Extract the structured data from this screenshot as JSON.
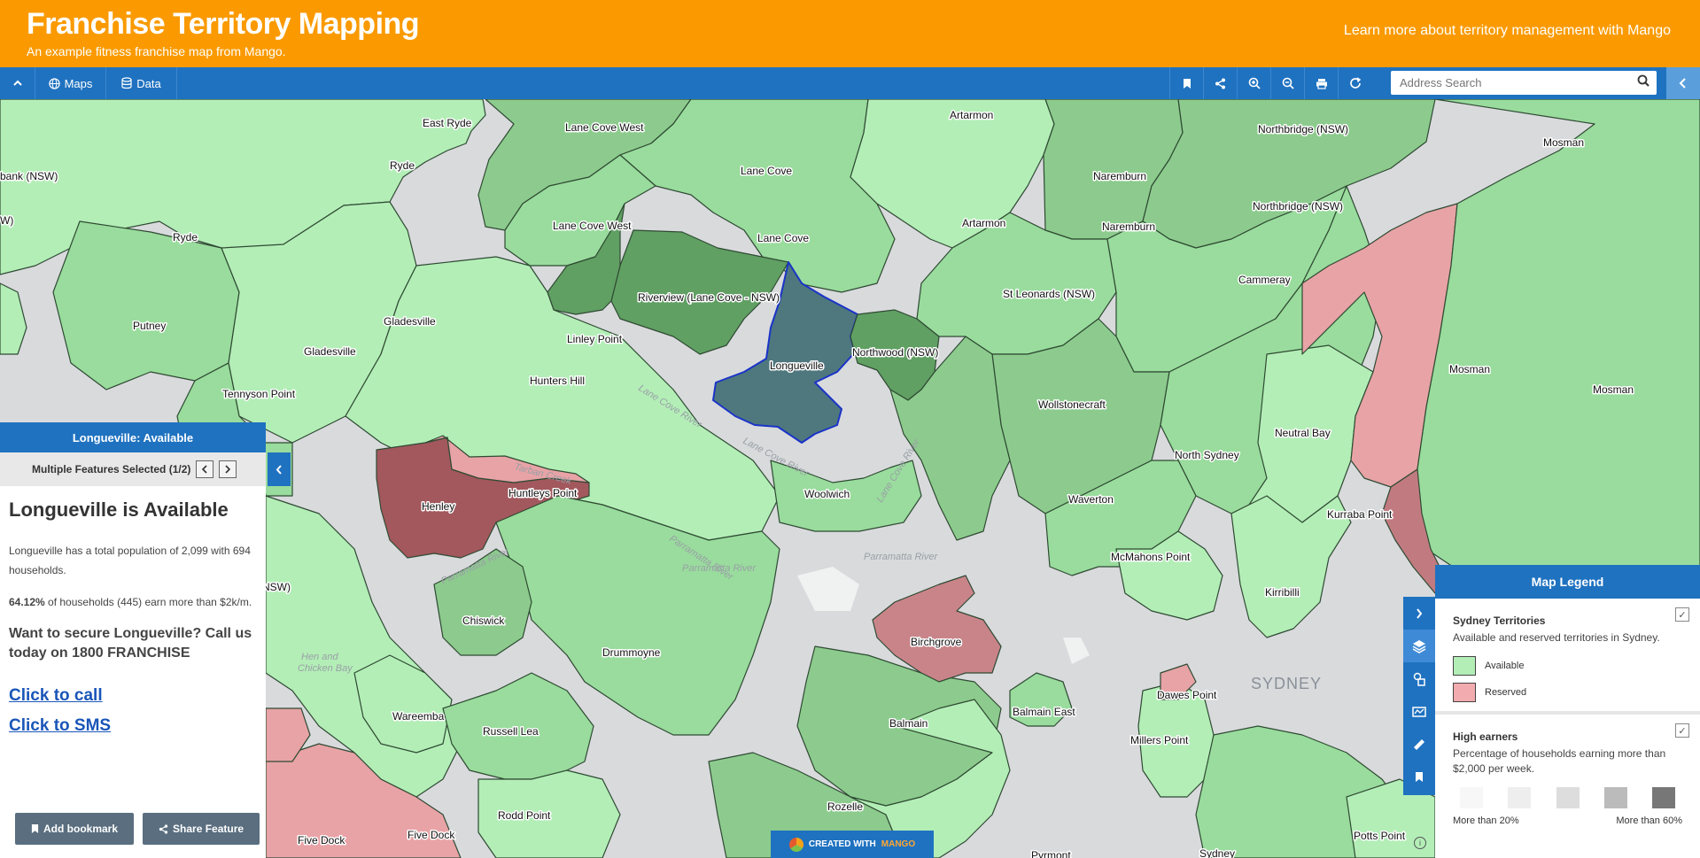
{
  "header": {
    "title": "Franchise Territory Mapping",
    "subtitle": "An example fitness franchise map from Mango.",
    "learn_more": "Learn more about territory management with Mango"
  },
  "toolbar": {
    "maps_label": "Maps",
    "data_label": "Data",
    "search_placeholder": "Address Search"
  },
  "map": {
    "labels": {
      "east_ryde": "East Ryde",
      "lane_cove_west_1": "Lane Cove West",
      "artarmon_1": "Artarmon",
      "northbridge_1": "Northbridge (NSW)",
      "mosman_1": "Mosman",
      "bank": "bank (NSW)",
      "ryde_1": "Ryde",
      "lane_cove_1": "Lane Cove",
      "naremburn_1": "Naremburn",
      "northbridge_2": "Northbridge (NSW)",
      "ryde_2": "Ryde",
      "lane_cove_west_2": "Lane Cove West",
      "artarmon_2": "Artarmon",
      "naremburn_2": "Naremburn",
      "lane_cove_2": "Lane Cove",
      "cammeray": "Cammeray",
      "riverview": "Riverview (Lane Cove - NSW)",
      "st_leonards": "St Leonards (NSW)",
      "putney": "Putney",
      "gladesville_1": "Gladesville",
      "linley_point": "Linley Point",
      "northwood": "Northwood (NSW)",
      "gladesville_2": "Gladesville",
      "longueville": "Longueville",
      "mosman_2": "Mosman",
      "hunters_hill": "Hunters Hill",
      "mosman_3": "Mosman",
      "tennyson_point": "Tennyson Point",
      "wollstonecraft": "Wollstonecraft",
      "neutral_bay": "Neutral Bay",
      "north_sydney": "North Sydney",
      "huntleys_point": "Huntleys Point",
      "woolwich": "Woolwich",
      "waverton": "Waverton",
      "henley": "Henley",
      "kurraba_point": "Kurraba Point",
      "mcmahons_point": "McMahons Point",
      "kirribilli": "Kirribilli",
      "chiswick": "Chiswick",
      "drummoyne": "Drummoyne",
      "birchgrove": "Birchgrove",
      "sydney_city": "SYDNEY",
      "dawes_point": "Dawes Point",
      "wareemba": "Wareemba",
      "balmain": "Balmain",
      "balmain_east": "Balmain East",
      "millers_point": "Millers Point",
      "russell_lea": "Russell Lea",
      "rodd_point": "Rodd Point",
      "rozelle": "Rozelle",
      "five_dock_1": "Five Dock",
      "five_dock_2": "Five Dock",
      "potts_point": "Potts Point",
      "sydney": "Sydney",
      "pyrmont": "Pyrmont",
      "nsw_edge": "NSW)",
      "w_edge": "W)"
    },
    "water_labels": {
      "lane_cove_river_1": "Lane Cove River",
      "lane_cove_river_2": "Lane Cove River",
      "lane_cove_river_3": "Lane Cove River",
      "parramatta_river_1": "Parramatta River",
      "parramatta_river_2": "Parramatta River",
      "parramatta_river_3": "Parramatta River",
      "parramatta_river_4": "Parramatta River",
      "tarban_creek": "Tarban Creek",
      "hen_chicken_1": "Hen and",
      "hen_chicken_2": "Chicken Bay"
    },
    "colors": {
      "available_light": "#b3eeb7",
      "available_mid": "#99dc9d",
      "available_darker": "#8ccb8d",
      "available_dark": "#60a063",
      "reserved_light": "#e8a3a6",
      "reserved_dark": "#a2585d",
      "selected": "#4e787e",
      "water": "#d8dadc"
    }
  },
  "feature_panel": {
    "header": "Longueville: Available",
    "multi_selected": "Multiple Features Selected (1/2)",
    "title": "Longueville is Available",
    "population_text": "Longueville has a total population of 2,099 with 694 households.",
    "earners_pct": "64.12%",
    "earners_text": " of households (445) earn more than $2k/m.",
    "call_to_action": "Want to secure Longueville? Call us today on 1800 FRANCHISE",
    "call_link": "Click to call",
    "sms_link": "Click to SMS",
    "bookmark_button": "Add bookmark",
    "share_button": "Share Feature"
  },
  "legend": {
    "title": "Map Legend",
    "territories": {
      "title": "Sydney Territories",
      "description": "Available and reserved territories in Sydney.",
      "available_label": "Available",
      "reserved_label": "Reserved",
      "available_color": "#b3eeb7",
      "reserved_color": "#f2abae"
    },
    "earners": {
      "title": "High earners",
      "description": "Percentage of households earning more than $2,000 per week.",
      "min_label": "More than 20%",
      "max_label": "More than 60%",
      "scale_colors": [
        "#f7f7f7",
        "#eeeeee",
        "#dddddd",
        "#bbbbbb",
        "#777777"
      ]
    }
  },
  "footer": {
    "created_with": "CREATED WITH",
    "brand": "MANGO"
  }
}
